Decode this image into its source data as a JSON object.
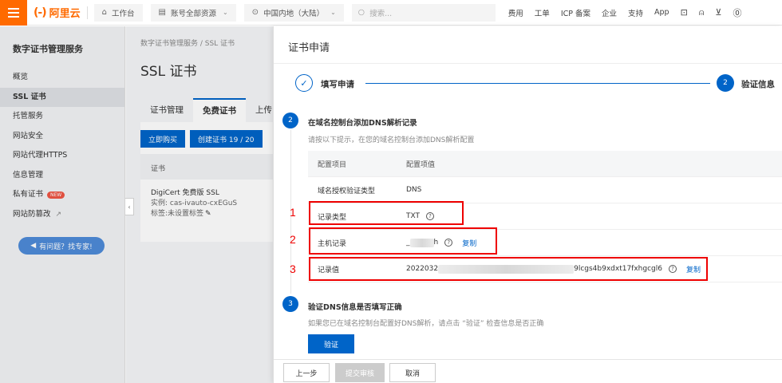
{
  "topbar": {
    "logo_text": "阿里云",
    "logo_mark": "(-)",
    "workbench": "工作台",
    "account_resources": "账号全部资源",
    "region": "中国内地（大陆）",
    "search_placeholder": "搜索...",
    "links": [
      "费用",
      "工单",
      "ICP 备案",
      "企业",
      "支持",
      "App"
    ]
  },
  "sidebar": {
    "title": "数字证书管理服务",
    "items": [
      {
        "label": "概览"
      },
      {
        "label": "SSL 证书"
      },
      {
        "label": "托管服务"
      },
      {
        "label": "网站安全"
      },
      {
        "label": "网站代理HTTPS"
      },
      {
        "label": "信息管理"
      },
      {
        "label": "私有证书",
        "badge": "NEW"
      },
      {
        "label": "网站防篡改"
      }
    ],
    "help_button": "有问题？找专家!"
  },
  "main": {
    "breadcrumb": "数字证书管理服务 / SSL 证书",
    "title": "SSL 证书",
    "tabs": [
      "证书管理",
      "免费证书",
      "上传"
    ],
    "buy_button": "立即购买",
    "create_button": "创建证书 19 / 20",
    "table_header": "证书",
    "cert_name": "DigiCert 免费版 SSL",
    "cert_instance": "实例: cas-ivauto-cxEGuS",
    "cert_tag": "标签:未设置标签"
  },
  "drawer": {
    "title": "证书申请",
    "step1": "填写申请",
    "step2_num": "2",
    "step2": "验证信息",
    "section2": {
      "num": "2",
      "title": "在域名控制台添加DNS解析记录",
      "desc": "请按以下提示，在您的域名控制台添加DNS解析配置"
    },
    "table": {
      "head_col1": "配置项目",
      "head_col2": "配置项值",
      "rows": [
        {
          "label": "域名授权验证类型",
          "value": "DNS"
        },
        {
          "label": "记录类型",
          "value": "TXT"
        },
        {
          "label": "主机记录",
          "value_left": "_",
          "value_right": "h"
        },
        {
          "label": "记录值",
          "value_left": "2022032",
          "value_right": "9lcgs4b9xdxt17fxhgcgl6"
        }
      ],
      "copy_label": "复制"
    },
    "section3": {
      "num": "3",
      "title": "验证DNS信息是否填写正确",
      "desc": "如果您已在域名控制台配置好DNS解析，请点击 “验证” 检查信息是否正确"
    },
    "verify_button": "验证",
    "annotations": [
      "1",
      "2",
      "3"
    ],
    "footer": {
      "prev": "上一步",
      "submit": "提交审核",
      "cancel": "取消"
    }
  }
}
